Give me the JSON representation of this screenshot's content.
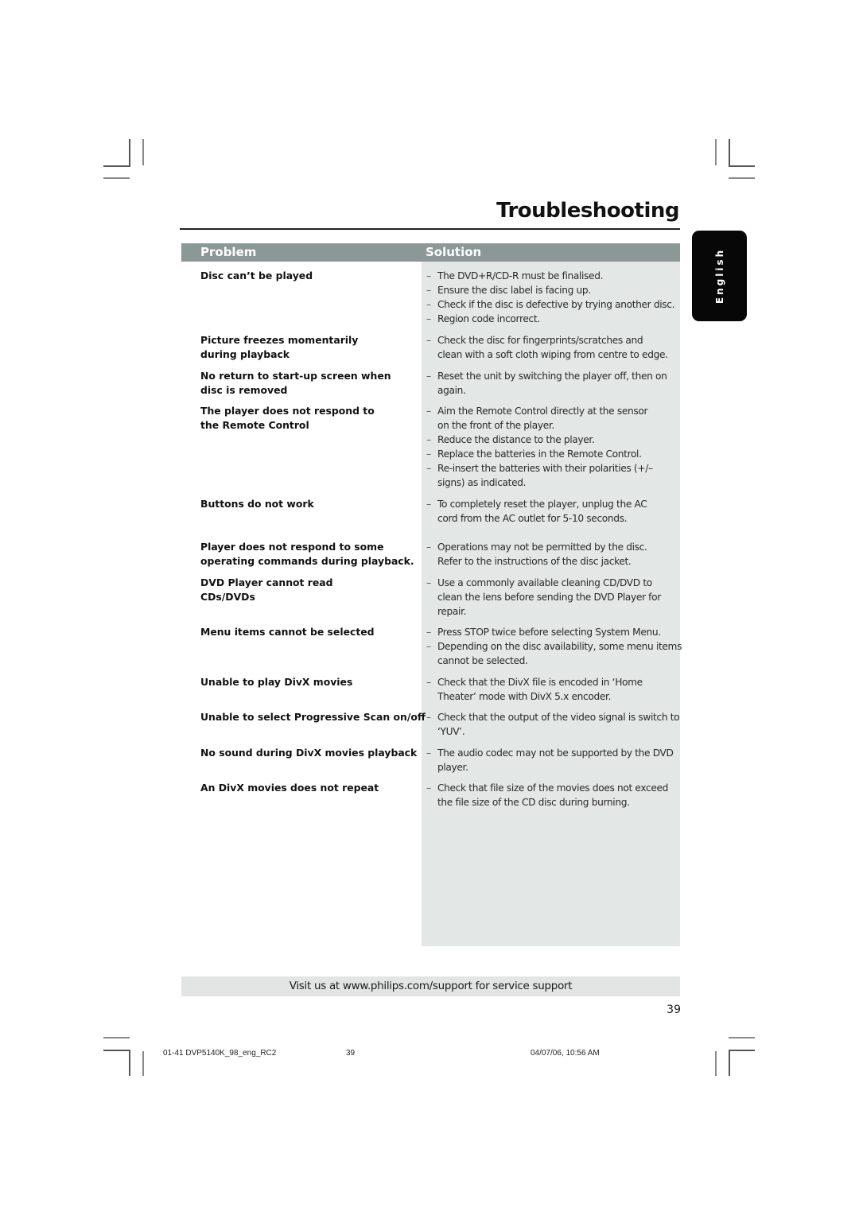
{
  "page": {
    "title": "Troubleshooting",
    "language_tab": "English",
    "page_number": "39"
  },
  "table": {
    "headers": {
      "problem": "Problem",
      "solution": "Solution"
    },
    "rows": [
      {
        "problem": [
          "Disc can’t be played"
        ],
        "solutions": [
          [
            "The DVD+R/CD-R must be finalised."
          ],
          [
            "Ensure the disc label is facing up."
          ],
          [
            "Check if the disc is defective by trying another disc."
          ],
          [
            "Region code incorrect."
          ]
        ]
      },
      {
        "problem": [
          "Picture freezes momentarily",
          "during playback"
        ],
        "solutions": [
          [
            "Check the disc for fingerprints/scratches and",
            "clean with a soft cloth wiping from centre to edge."
          ]
        ]
      },
      {
        "problem": [
          "No return to start-up screen when",
          "disc is removed"
        ],
        "solutions": [
          [
            "Reset the unit by switching the player off, then on",
            "again."
          ]
        ]
      },
      {
        "problem": [
          "The player does not respond to",
          "the Remote Control"
        ],
        "solutions": [
          [
            "Aim the Remote Control directly at the sensor",
            "on the front of the player."
          ],
          [
            "Reduce the distance to the player."
          ],
          [
            "Replace the batteries in the Remote Control."
          ],
          [
            "Re-insert the batteries with their polarities (+/–",
            "signs) as indicated."
          ]
        ]
      },
      {
        "problem": [
          "Buttons do not work"
        ],
        "solutions": [
          [
            "To completely reset the player, unplug the AC",
            "cord from the AC outlet for 5-10 seconds."
          ]
        ]
      },
      {
        "problem": [
          "Player does not respond to some",
          "operating commands during playback."
        ],
        "solutions": [
          [
            "Operations may not be permitted by the disc.",
            "Refer to the instructions of  the disc jacket."
          ]
        ]
      },
      {
        "problem": [
          "DVD Player cannot read",
          "CDs/DVDs"
        ],
        "solutions": [
          [
            "Use a commonly available cleaning CD/DVD to",
            "clean the lens before sending the DVD Player for",
            "repair."
          ]
        ]
      },
      {
        "problem": [
          "Menu items cannot be selected"
        ],
        "solutions": [
          [
            "Press STOP twice before selecting System Menu."
          ],
          [
            "Depending on the disc availability, some menu items",
            "cannot be selected."
          ]
        ]
      },
      {
        "problem": [
          "Unable to play DivX movies"
        ],
        "solutions": [
          [
            "Check that the DivX file is encoded in ‘Home",
            "Theater’ mode with DivX 5.x encoder."
          ]
        ]
      },
      {
        "problem": [
          "Unable to select Progressive Scan on/off"
        ],
        "solutions": [
          [
            "Check that the output of the video signal is switch to",
            "‘YUV’."
          ]
        ]
      },
      {
        "problem": [
          "No sound during DivX movies playback"
        ],
        "solutions": [
          [
            "The audio codec may not be supported by the DVD",
            "player."
          ]
        ]
      },
      {
        "problem": [
          "An DivX movies does not repeat"
        ],
        "solutions": [
          [
            "Check that file size of the movies does not exceed",
            "the file size of the CD disc during burning."
          ]
        ]
      }
    ]
  },
  "support": {
    "text": "Visit us at www.philips.com/support for service support"
  },
  "footer": {
    "file": "01-41 DVP5140K_98_eng_RC2",
    "page": "39",
    "timestamp": "04/07/06, 10:56 AM"
  },
  "icons": {
    "bullet": "–"
  }
}
